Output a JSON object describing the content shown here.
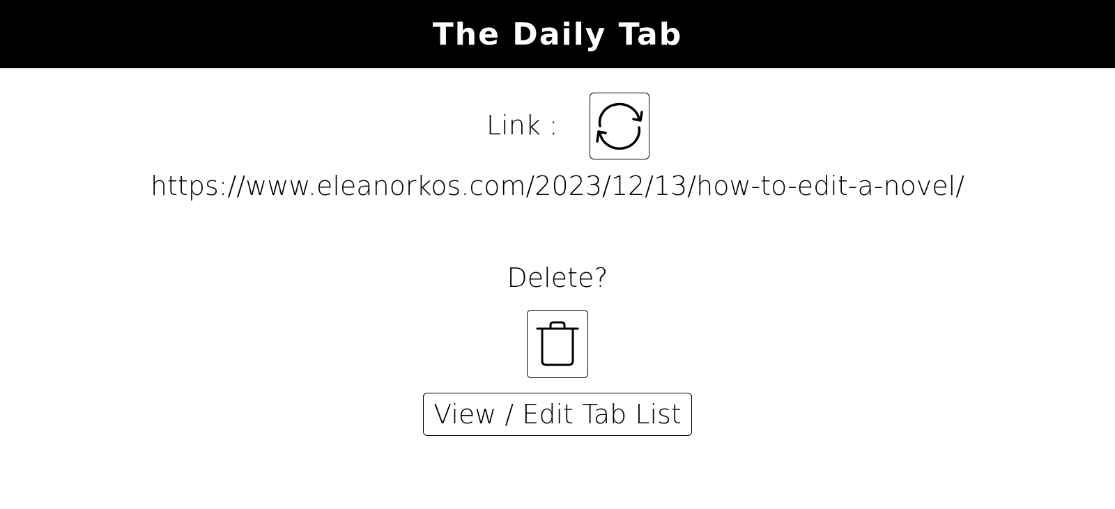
{
  "header": {
    "title": "The Daily Tab"
  },
  "link": {
    "label": "Link :",
    "refresh_icon": "refresh-icon",
    "url": "https://www.eleanorkos.com/2023/12/13/how-to-edit-a-novel/"
  },
  "delete": {
    "label": "Delete?",
    "trash_icon": "trash-icon"
  },
  "actions": {
    "view_edit_label": "View / Edit Tab List"
  },
  "colors": {
    "header_bg": "#000000",
    "header_text": "#ffffff",
    "page_bg": "#ffffff",
    "border": "#000000"
  }
}
